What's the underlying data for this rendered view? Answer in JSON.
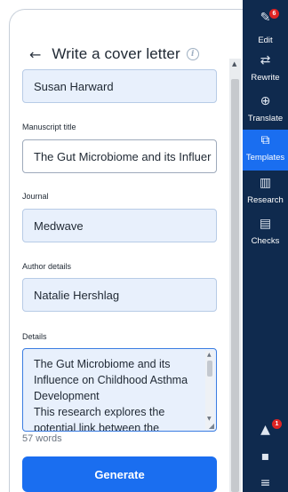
{
  "header": {
    "title": "Write a cover letter"
  },
  "form": {
    "name_value": "Susan Harward",
    "manuscript_label": "Manuscript title",
    "manuscript_value": "The Gut Microbiome and its Influer",
    "journal_label": "Journal",
    "journal_value": "Medwave",
    "author_label": "Author details",
    "author_value": "Natalie Hershlag",
    "details_label": "Details",
    "details_lines": [
      "The Gut Microbiome and its",
      "Influence on Childhood Asthma",
      "Development",
      "This research explores the",
      "potential link between the"
    ],
    "word_count": "57 words",
    "generate_label": "Generate"
  },
  "sidebar": {
    "items": [
      {
        "label": "Edit",
        "icon": "pen-icon",
        "active": false
      },
      {
        "label": "Rewrite",
        "icon": "rewrite-icon",
        "active": false
      },
      {
        "label": "Translate",
        "icon": "globe-icon",
        "active": false
      },
      {
        "label": "Templates",
        "icon": "templates-icon",
        "active": true
      },
      {
        "label": "Research",
        "icon": "library-icon",
        "active": false
      },
      {
        "label": "Checks",
        "icon": "checklist-icon",
        "active": false
      }
    ],
    "edit_badge": "6",
    "notifications_badge": "1"
  },
  "colors": {
    "sidebar_bg": "#0f2a4e",
    "accent": "#1a6ef0",
    "field_bg": "#e8f0fc",
    "badge": "#e02424"
  }
}
